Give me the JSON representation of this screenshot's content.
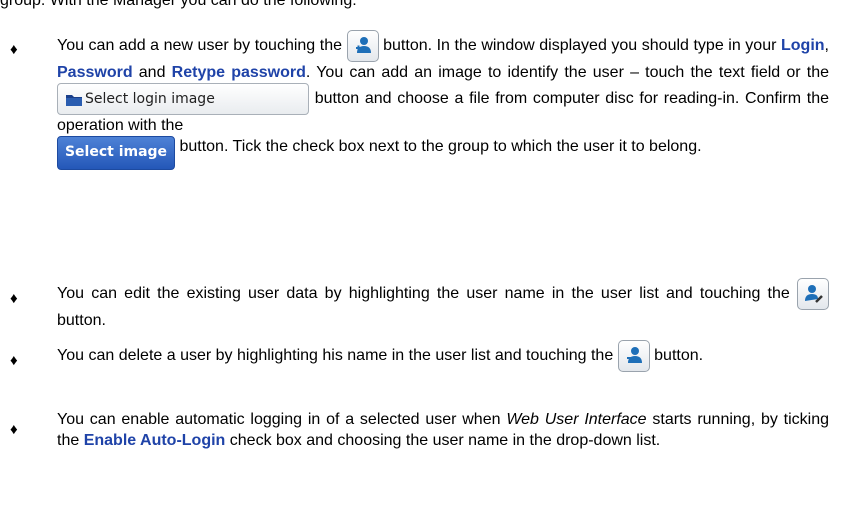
{
  "intro": "group. With the Manager you can do the following:",
  "bullet_glyph": "♦",
  "b1": {
    "t1": "You can add a new user by touching the",
    "t2": "button. In the window displayed you should type in your",
    "login": "Login",
    "comma": ",",
    "password": "Password",
    "and": "and",
    "retype": "Retype password",
    "t3": ". You can add an image to identify the user – touch the text field or the",
    "select_login_image": "Select login image",
    "t4": "button and choose a file from computer disc for reading-in. Confirm the operation with the",
    "select_image": "Select image",
    "t5": "button. Tick the check box next to the group to which the user it to belong."
  },
  "b2": {
    "t1": "You can edit the existing user data by highlighting the user name in the user list and touching the",
    "t2": "button."
  },
  "b3": {
    "t1": "You can delete a user by highlighting his name in the user list and touching the",
    "t2": "button."
  },
  "b4": {
    "t1": "You can enable automatic logging in of a selected user when",
    "web_ui": "Web User Interface",
    "t2": "starts running, by ticking the",
    "enable_auto": "Enable Auto-Login",
    "t3": "check box and choosing the user name in the drop-down list."
  },
  "icons": {
    "add": "add-user-icon",
    "edit": "edit-user-icon",
    "delete": "delete-user-icon",
    "folder": "folder-icon"
  },
  "colors": {
    "emphasis": "#1f43a8",
    "primary_button": "#2d62c4"
  }
}
